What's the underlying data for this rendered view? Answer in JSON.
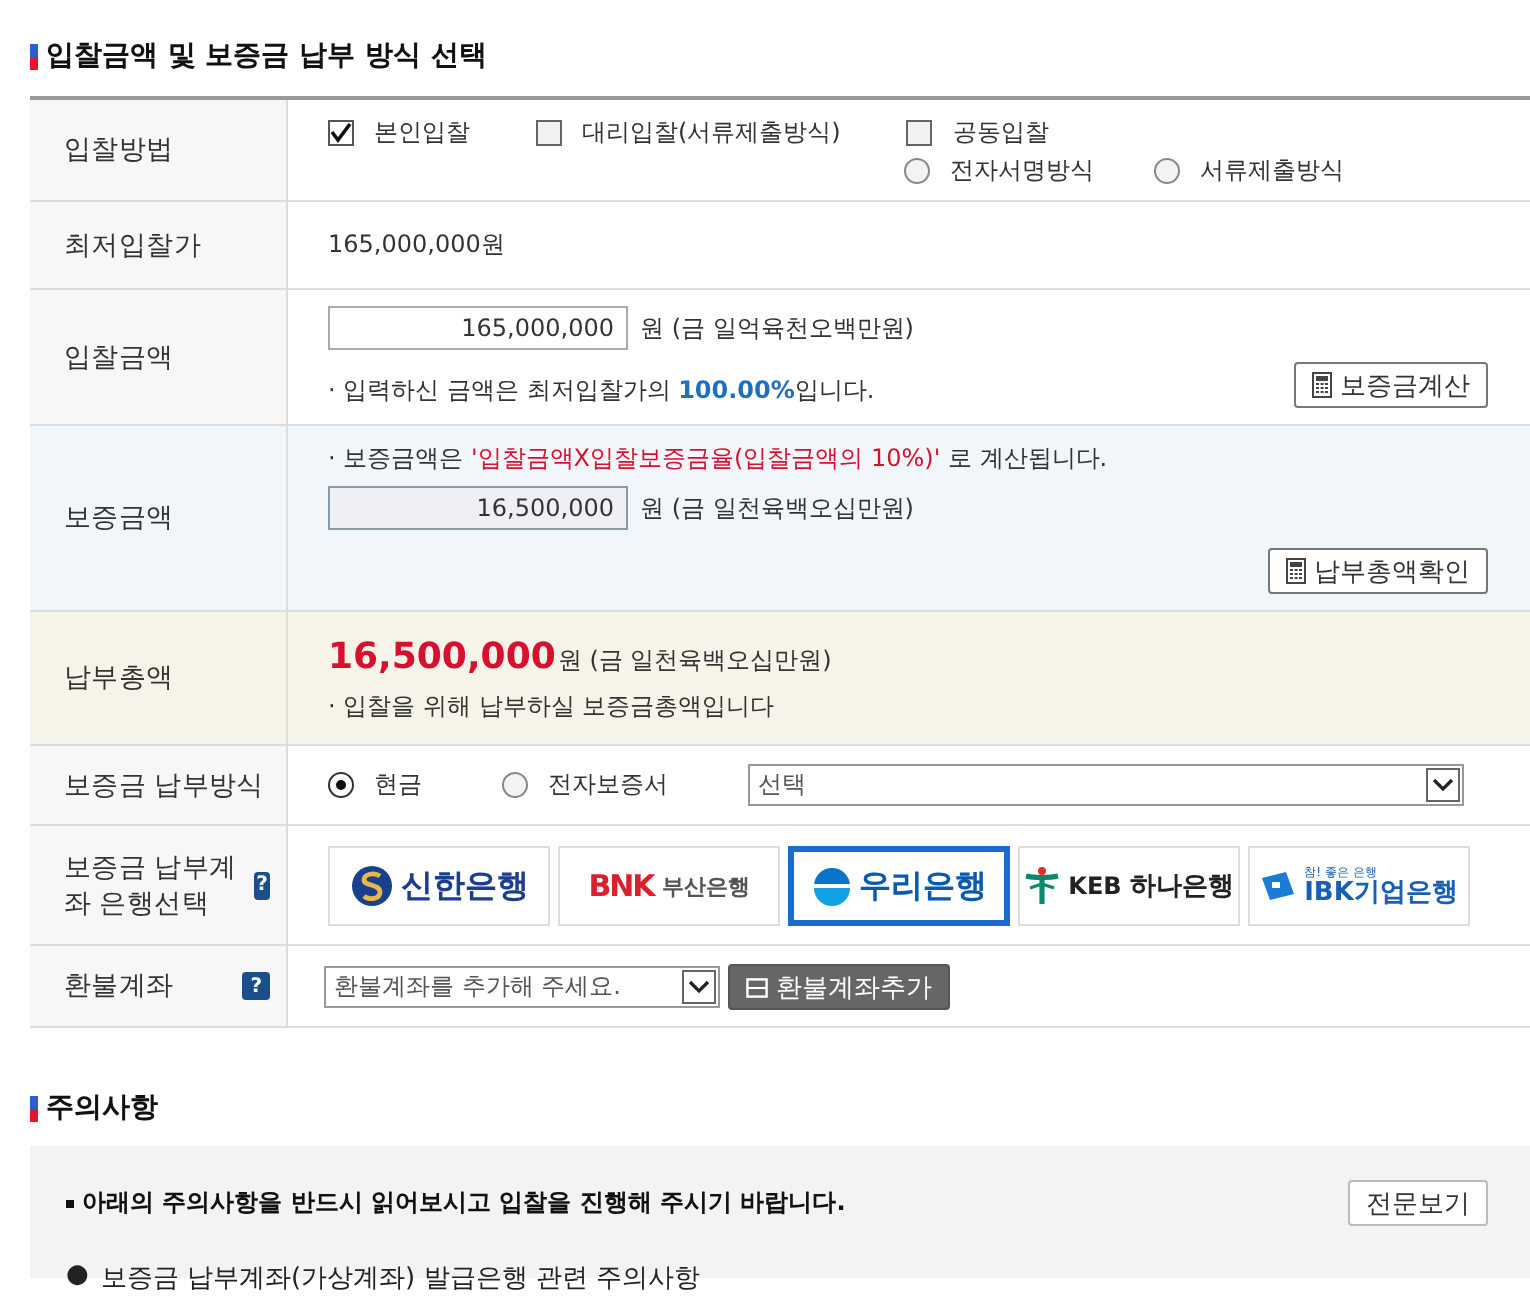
{
  "section_title": "입찰금액 및 보증금 납부 방식 선택",
  "rows": [
    {
      "kind": "bid_method",
      "label": "입찰방법",
      "options": [
        {
          "label": "본인입찰",
          "checked": true
        },
        {
          "label": "대리입찰(서류제출방식)",
          "checked": false
        },
        {
          "label": "공동입찰",
          "checked": false
        }
      ],
      "sub_options": [
        {
          "label": "전자서명방식",
          "selected": false
        },
        {
          "label": "서류제출방식",
          "selected": false
        }
      ]
    },
    {
      "kind": "text",
      "label": "최저입찰가",
      "value": "165,000,000원"
    },
    {
      "kind": "bid_amount",
      "label": "입찰금액",
      "input_value": "165,000,000",
      "unit": "원 (금 일억육천오백만원)",
      "note": "· 입력하신 금액은 최저입찰가의 ",
      "highlight": "100.00%",
      "note_end": "입니다.",
      "button": "보증금계산"
    },
    {
      "kind": "deposit",
      "label": "보증금액",
      "note": "· 보증금액은 ",
      "highlight": "'입찰금액X입찰보증금율(입찰금액의 10%)'",
      "note_end": " 로 계산됩니다.",
      "input_value": "16,500,000",
      "disabled": true,
      "unit": "원 (금 일천육백오십만원)",
      "button": "납부총액확인"
    },
    {
      "kind": "total",
      "label": "납부총액",
      "amount": "16,500,000",
      "unit": "원 (금 일천육백오십만원)",
      "note": "· 입찰을 위해 납부하실 보증금총액입니다"
    },
    {
      "kind": "pay_method",
      "label": "보증금 납부방식",
      "options": [
        {
          "label": "현금",
          "selected": true
        },
        {
          "label": "전자보증서",
          "selected": false
        }
      ],
      "select": "선택"
    },
    {
      "kind": "banks",
      "label": "보증금 납부계좌 은행선택",
      "help": "?",
      "banks": [
        {
          "kind": "shinhan",
          "name": "신한은행",
          "selected": false
        },
        {
          "kind": "bnk",
          "prefix": "BNK",
          "name": "부산은행",
          "selected": false
        },
        {
          "kind": "woori",
          "name": "우리은행",
          "selected": true
        },
        {
          "kind": "hana",
          "prefix": "KEB",
          "name": "하나은행",
          "selected": false
        },
        {
          "kind": "ibk",
          "tagline": "참! 좋은 은행",
          "name": "IBK기업은행",
          "selected": false
        }
      ]
    },
    {
      "kind": "refund",
      "label": "환불계좌",
      "help": "?",
      "select": "환불계좌를 추가해 주세요.",
      "button": "환불계좌추가"
    }
  ],
  "notice": {
    "title": "주의사항",
    "lead": "아래의 주의사항을 반드시 읽어보시고 입찰을 진행해 주시기 바랍니다.",
    "button": "전문보기",
    "item_bullet": "●",
    "item": "보증금 납부계좌(가상계좌) 발급은행 관련 주의사항"
  }
}
